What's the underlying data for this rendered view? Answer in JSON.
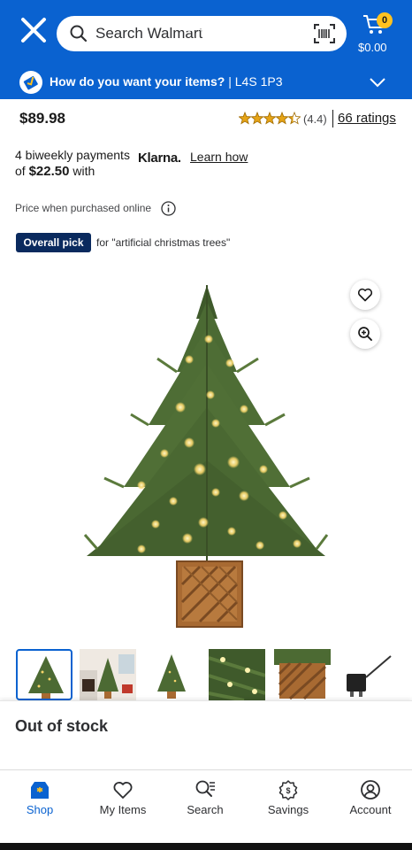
{
  "header": {
    "search_placeholder": "Search Walmart",
    "photo_counter": "1 of 6",
    "cart_count": "0",
    "cart_total": "$0.00",
    "fulfillment_question": "How do you want your items?",
    "postal_code": " | L4S 1P3"
  },
  "product": {
    "price": "$89.98",
    "rating_value": "(4.4)",
    "ratings_count": "66 ratings",
    "rating_stars": 4.4
  },
  "klarna": {
    "text_before": "4 biweekly payments of ",
    "amount": "$22.50",
    "text_after": " with",
    "logo": "Klarna.",
    "learn_link": "Learn how"
  },
  "price_note": "Price when purchased online",
  "badge": {
    "label": "Overall pick",
    "context": "for \"artificial christmas trees\""
  },
  "availability": "Out of stock",
  "bottom_nav": {
    "shop": "Shop",
    "my_items": "My Items",
    "search": "Search",
    "savings": "Savings",
    "account": "Account"
  },
  "colors": {
    "brand_blue": "#0a62d0",
    "spark_yellow": "#ffc220",
    "badge_navy": "#0a2a5e",
    "star_gold": "#e6a417"
  }
}
